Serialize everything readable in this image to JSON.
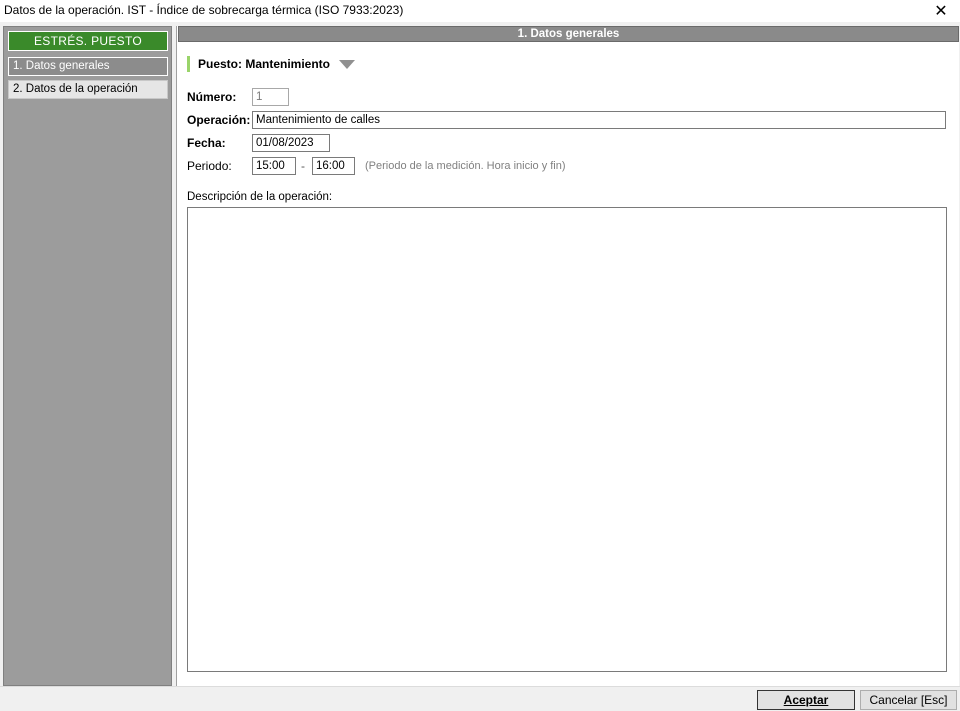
{
  "window": {
    "title": "Datos de la operación. IST - Índice de sobrecarga térmica (ISO 7933:2023)",
    "close_icon": "close-icon"
  },
  "sidebar": {
    "header": "ESTRÉS. PUESTO",
    "items": [
      {
        "label": "1. Datos generales",
        "active": true
      },
      {
        "label": "2. Datos de la operación",
        "active": false
      }
    ]
  },
  "main": {
    "section_title": "1. Datos generales",
    "puesto_label": "Puesto: Mantenimiento",
    "fields": {
      "numero": {
        "label": "Número:",
        "value": "1"
      },
      "operacion": {
        "label": "Operación:",
        "value": "Mantenimiento de calles"
      },
      "fecha": {
        "label": "Fecha:",
        "value": "01/08/2023"
      },
      "periodo": {
        "label": "Periodo:",
        "start": "15:00",
        "separator": "-",
        "end": "16:00",
        "hint": "(Periodo de la medición. Hora inicio y fin)"
      },
      "descripcion": {
        "label": "Descripción de la operación:",
        "value": ""
      }
    }
  },
  "footer": {
    "accept_label": "Aceptar",
    "cancel_label": "Cancelar  [Esc]"
  },
  "colors": {
    "sidebar_header": "#3a8a2a",
    "sidebar_bg": "#9c9c9c",
    "section_header": "#8a8a8a",
    "puesto_accent": "#9ad46a"
  }
}
